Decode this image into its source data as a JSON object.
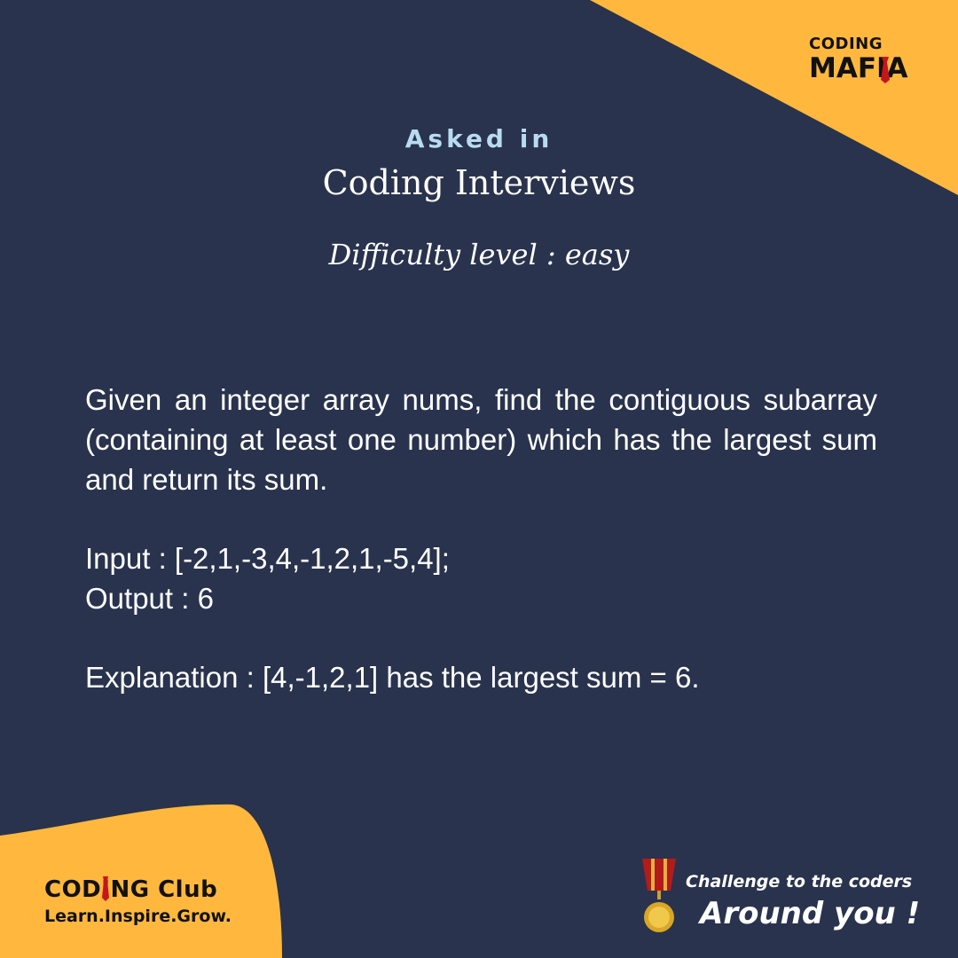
{
  "colors": {
    "background": "#29334d",
    "accent": "#ffb83d",
    "heading_light": "#b9dbf0",
    "text": "#ffffff",
    "logo_text": "#111111",
    "tie_red": "#c4161c"
  },
  "logo_top": {
    "line1": "CODING",
    "line2": "MAFIA",
    "icon": "tie-icon"
  },
  "header": {
    "asked_in": "Asked in",
    "title": "Coding Interviews",
    "difficulty": "Difficulty level : easy"
  },
  "problem": {
    "statement": "Given an integer array nums, find the contiguous subarray (containing at least one number) which has the largest sum and return its sum.",
    "input": "Input : [-2,1,-3,4,-1,2,1,-5,4];",
    "output": "Output : 6",
    "explanation": "Explanation : [4,-1,2,1] has the largest sum = 6."
  },
  "logo_bottom": {
    "line1": "CODING Club",
    "tagline": "Learn.Inspire.Grow.",
    "icon": "tie-icon"
  },
  "challenge": {
    "line1": "Challenge to the coders",
    "line2": "Around you !",
    "icon": "medal-icon"
  }
}
